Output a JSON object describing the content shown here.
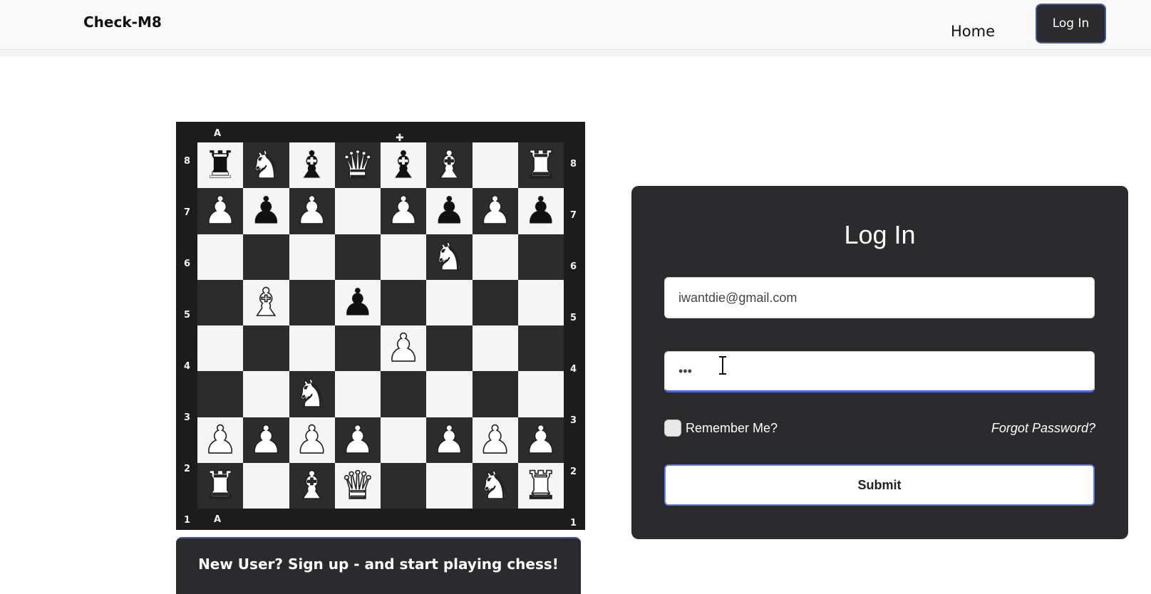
{
  "header": {
    "brand": "Check-M8",
    "nav_home": "Home",
    "nav_login": "Log In"
  },
  "board": {
    "file_label_top": "A",
    "file_label_bottom": "A",
    "ranks_left": [
      "8",
      "7",
      "6",
      "5",
      "4",
      "3",
      "2",
      "1"
    ],
    "ranks_right": [
      "8",
      "7",
      "6",
      "5",
      "4",
      "3",
      "2",
      "1"
    ],
    "rows": [
      [
        "♜b",
        "♞w",
        "♝b",
        "♛w",
        "♝b",
        "♝w",
        "",
        "♜w"
      ],
      [
        "♟w",
        "♟b",
        "♟w",
        "",
        "♟w",
        "♟b",
        "♟w",
        "♟b"
      ],
      [
        "",
        "",
        "",
        "",
        "",
        "♞w",
        "",
        ""
      ],
      [
        "",
        "♝w",
        "",
        "♟b",
        "",
        "",
        "",
        ""
      ],
      [
        "",
        "",
        "",
        "",
        "♟w",
        "",
        "",
        ""
      ],
      [
        "",
        "",
        "♞w",
        "",
        "",
        "",
        "",
        ""
      ],
      [
        "♟w",
        "♟w",
        "♟w",
        "♟w",
        "",
        "♟w",
        "♟w",
        "♟w"
      ],
      [
        "♜w",
        "",
        "♝w",
        "♛w",
        "",
        "",
        "♞w",
        "♜w"
      ]
    ],
    "crown_mark": "✚"
  },
  "signup": {
    "text": "New User? Sign up - and start playing chess!"
  },
  "login": {
    "title": "Log In",
    "email_value": "iwantdie@gmail.com",
    "password_value": "•••",
    "remember_label": "Remember Me?",
    "forgot_label": "Forgot Password?",
    "submit_label": "Submit"
  }
}
